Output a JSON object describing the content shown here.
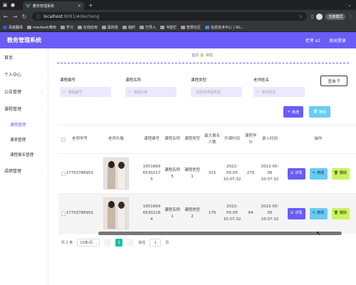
{
  "browser": {
    "tab_title": "教务管理系统",
    "url_host": "localhost",
    "url_path": ":8081/#/kecheng",
    "incognito_label": "无痕模式",
    "bookmarks": [
      "百度翻译",
      "macbook寓用",
      "学习",
      "在线应用",
      "黑科技",
      "临时",
      "已导入",
      "书签栏",
      "智慧社区",
      "信息技术中心 | SG..."
    ]
  },
  "app": {
    "title": "教务管理系统",
    "header_user": "老师 a1",
    "header_logout": "退出登录"
  },
  "sidebar": {
    "items": [
      {
        "label": "首页"
      },
      {
        "label": "个人中心"
      },
      {
        "label": "公告管理"
      },
      {
        "label": "课程管理"
      }
    ],
    "subitems": [
      {
        "label": "课程管理"
      },
      {
        "label": "课表管理"
      },
      {
        "label": "课程报名管理"
      }
    ],
    "last_item": {
      "label": "成绩管理"
    }
  },
  "breadcrumb": {
    "home": "首页",
    "current": "课程"
  },
  "filters": [
    {
      "label": "课程编号",
      "placeholder": "课程编号"
    },
    {
      "label": "课程名称",
      "placeholder": "课程名称"
    },
    {
      "label": "课程类型",
      "placeholder": "请选择课程类型"
    },
    {
      "label": "老师姓名",
      "placeholder": "老师姓名"
    }
  ],
  "buttons": {
    "query": "查询",
    "add": "新增",
    "delete": "删除"
  },
  "table": {
    "headers": [
      "老师学号",
      "老师头像",
      "课程编号",
      "课程名称",
      "课程类型",
      "最大报名人数",
      "开课时间",
      "课程学分",
      "录入时间",
      "操作"
    ],
    "rows": [
      {
        "teacher_no": "17703786901",
        "course_no": "16516696530217 5",
        "course_name": "课程名称5",
        "course_type": "课程类型1",
        "max": "315",
        "start": "2022-05-05 10:07:32",
        "credit": "275",
        "entered": "2022-05-05 10:07:32"
      },
      {
        "teacher_no": "17703786901",
        "course_no": "16516696530218 4",
        "course_name": "课程名称1",
        "course_type": "课程类型2",
        "max": "176",
        "start": "2022-05-05 10:07:32",
        "credit": "94",
        "entered": "2022-05-05 10:07:32"
      }
    ],
    "ops": {
      "detail": "详情",
      "edit": "修改",
      "remove": "删除"
    }
  },
  "pager": {
    "total": "共 2 条",
    "page_size": "10条/页",
    "current": "1",
    "goto_label": "前往",
    "goto_value": "1",
    "page_suffix": "页"
  }
}
